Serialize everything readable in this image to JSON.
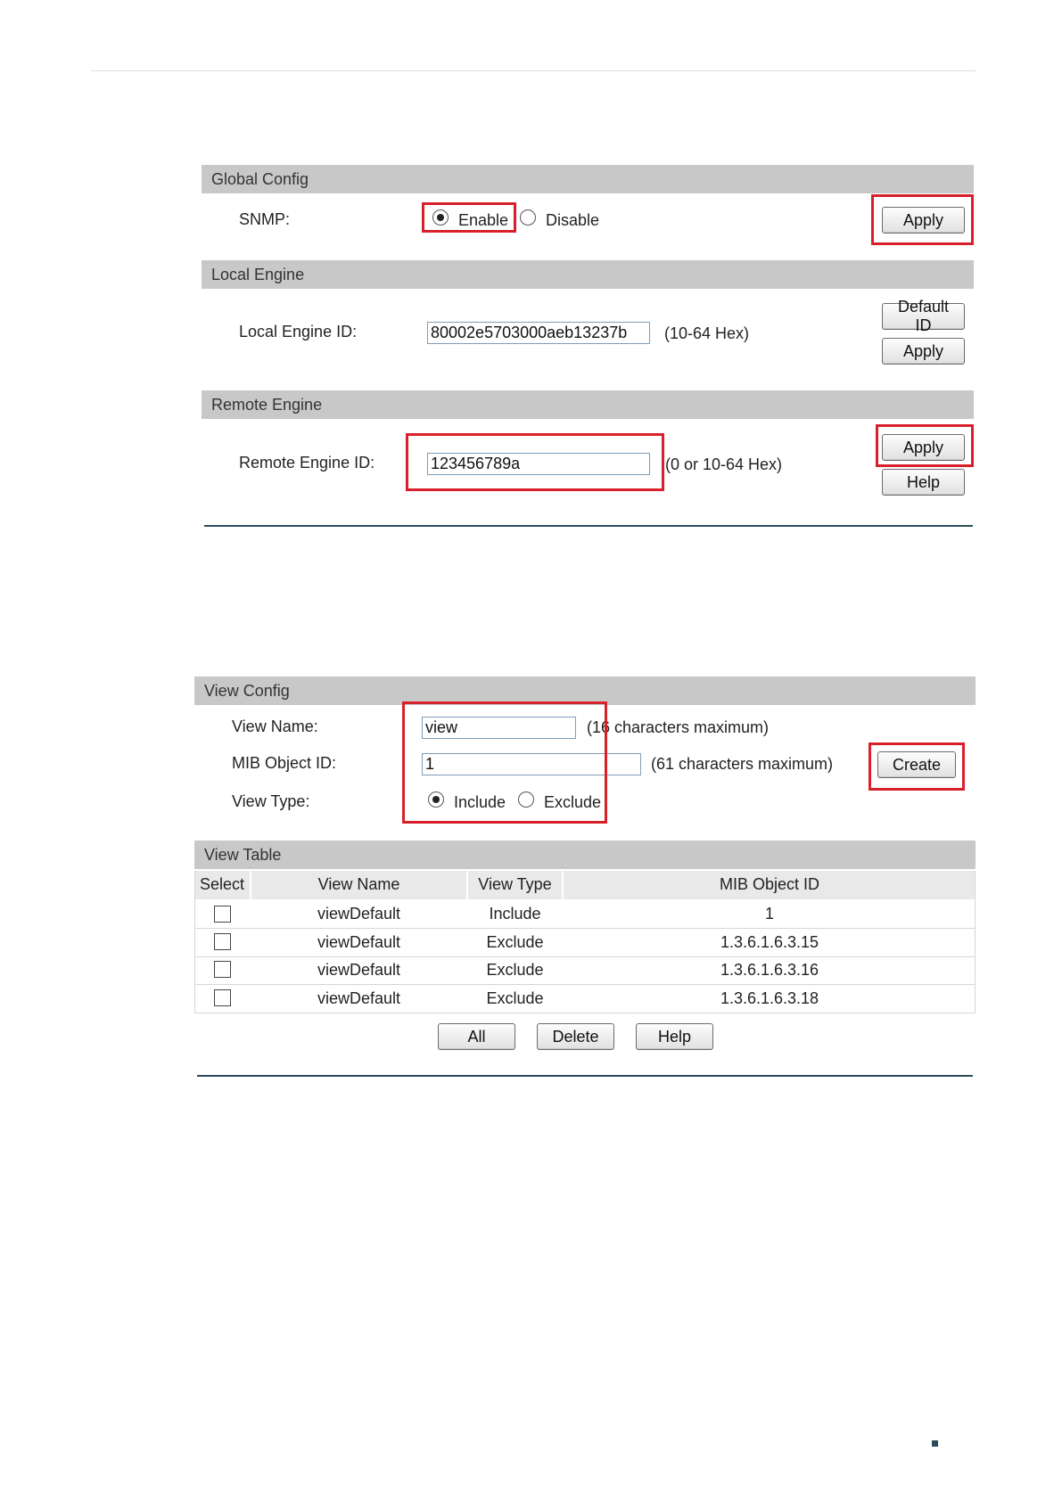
{
  "global_config": {
    "title": "Global Config",
    "snmp_label": "SNMP:",
    "enable_label": "Enable",
    "disable_label": "Disable",
    "snmp_selected": "Enable",
    "apply_label": "Apply"
  },
  "local_engine": {
    "title": "Local Engine",
    "id_label": "Local Engine ID:",
    "id_value": "80002e5703000aeb13237b",
    "hint": "(10-64 Hex)",
    "default_id_label": "Default ID",
    "apply_label": "Apply"
  },
  "remote_engine": {
    "title": "Remote Engine",
    "id_label": "Remote Engine ID:",
    "id_value": "123456789a",
    "hint": "(0 or 10-64 Hex)",
    "apply_label": "Apply",
    "help_label": "Help"
  },
  "view_config": {
    "title": "View Config",
    "view_name_label": "View Name:",
    "view_name_value": "view",
    "view_name_hint": "(16 characters maximum)",
    "mib_label": "MIB Object ID:",
    "mib_value": "1",
    "mib_hint": "(61 characters maximum)",
    "view_type_label": "View Type:",
    "include_label": "Include",
    "exclude_label": "Exclude",
    "view_type_selected": "Include",
    "create_label": "Create"
  },
  "view_table": {
    "title": "View Table",
    "columns": [
      "Select",
      "View Name",
      "View Type",
      "MIB Object ID"
    ],
    "rows": [
      {
        "view_name": "viewDefault",
        "view_type": "Include",
        "mib_object_id": "1"
      },
      {
        "view_name": "viewDefault",
        "view_type": "Exclude",
        "mib_object_id": "1.3.6.1.6.3.15"
      },
      {
        "view_name": "viewDefault",
        "view_type": "Exclude",
        "mib_object_id": "1.3.6.1.6.3.16"
      },
      {
        "view_name": "viewDefault",
        "view_type": "Exclude",
        "mib_object_id": "1.3.6.1.6.3.18"
      }
    ],
    "all_label": "All",
    "delete_label": "Delete",
    "help_label": "Help"
  },
  "colors": {
    "highlight": "#d8202a",
    "header_bg": "#c8c8c8",
    "rule": "#2d4a5a"
  }
}
